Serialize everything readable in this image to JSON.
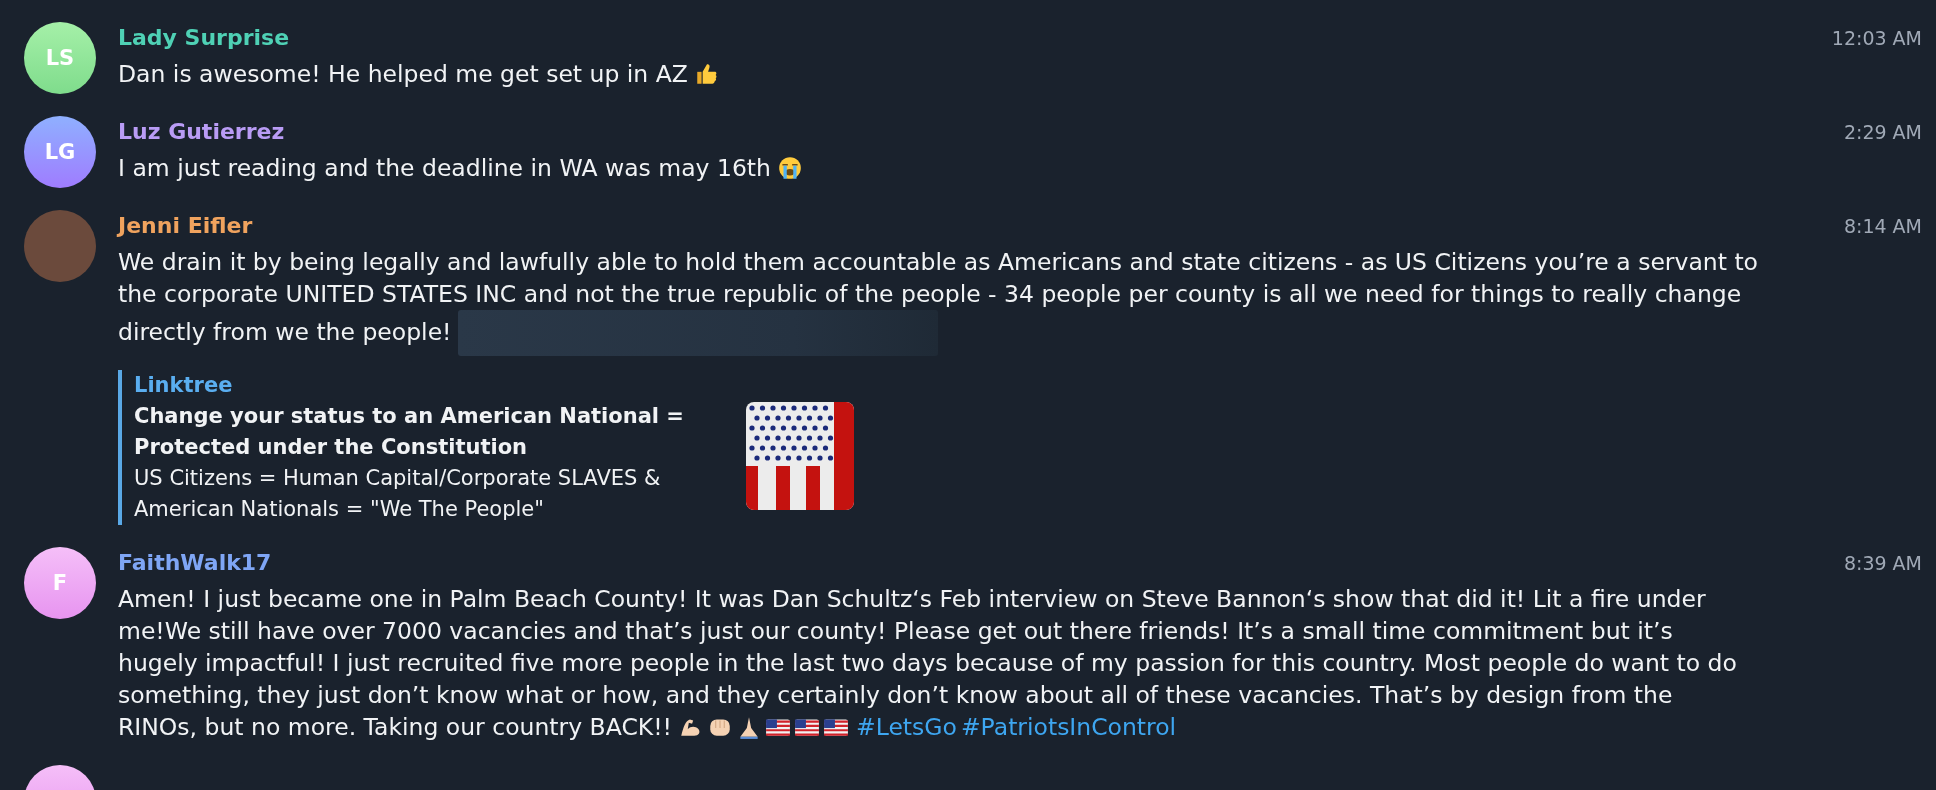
{
  "messages": [
    {
      "kind": "initials",
      "initials": "LS",
      "name": "Lady Surprise",
      "time": "12:03 AM",
      "text": "Dan is awesome! He helped me get set up in AZ",
      "icons": [
        {
          "kind": "thumbs_up"
        }
      ]
    },
    {
      "kind": "initials",
      "initials": "LG",
      "name": "Luz Gutierrez",
      "time": "2:29 AM",
      "text": "I am just reading and the deadline in WA was may 16th",
      "icons": [
        {
          "kind": "crying_face"
        }
      ]
    },
    {
      "kind": "photo",
      "name": "Jenni Eifler",
      "time": "8:14 AM",
      "text": "We drain it by being legally and lawfully able to hold them accountable as Americans and state citizens - as US Citizens you’re a servant to the corporate UNITED STATES INC and not the true republic of the people - 34 people per county is all we need for things to really change directly from we the people!",
      "blurred_link": true,
      "preview": {
        "site": "Linktree",
        "title": "Change your status to an American National = Protected under the Constitution",
        "description": "US Citizens = Human Capital/Corporate SLAVES & American Nationals = \"We The People\""
      }
    },
    {
      "kind": "initials",
      "initials": "F",
      "name": "FaithWalk17",
      "time": "8:39 AM",
      "text": "Amen! I just became one in Palm Beach County! It was Dan Schultz‘s Feb interview on Steve Bannon‘s show that did it! Lit a fire under me!We still have over 7000 vacancies and that’s just our county! Please get out there friends! It’s a small time commitment but it’s hugely impactful! I just recruited five more people in the last two days because of my passion for this country. Most people do want to do something, they just don’t know what or how, and they certainly don’t know about all of these vacancies. That’s by design from the RINOs, but no more. Taking our country BACK!!",
      "icons": [
        {
          "kind": "flexed_arm"
        },
        {
          "kind": "fist"
        },
        {
          "kind": "praying_hands"
        },
        {
          "kind": "flag"
        },
        {
          "kind": "flag"
        },
        {
          "kind": "flag"
        }
      ],
      "hashtags": [
        "#LetsGo",
        "#PatriotsInControl"
      ]
    },
    {
      "kind": "cut_off"
    }
  ]
}
